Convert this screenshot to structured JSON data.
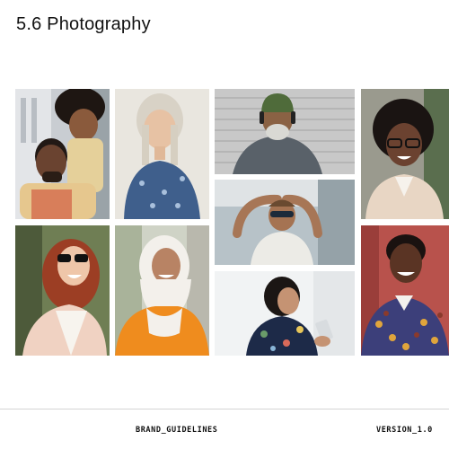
{
  "page": {
    "title": "5.6 Photography"
  },
  "photos": [
    {
      "id": "father-daughter",
      "subject": "smiling father with daughter on shoulders"
    },
    {
      "id": "older-woman",
      "subject": "smiling older woman with grey hair"
    },
    {
      "id": "man-beanie-headphones",
      "subject": "smiling bearded man in green beanie with headphones"
    },
    {
      "id": "woman-glasses",
      "subject": "smiling woman with natural hair and glasses"
    },
    {
      "id": "man-sunglasses-stretch",
      "subject": "man in sunglasses stretching arms above head"
    },
    {
      "id": "woman-red-hair-sunglasses",
      "subject": "laughing woman with red curly hair and sunglasses"
    },
    {
      "id": "woman-hijab",
      "subject": "smiling woman in white hijab and orange top"
    },
    {
      "id": "woman-phone",
      "subject": "woman in floral dress looking at phone"
    },
    {
      "id": "man-patterned-shirt",
      "subject": "laughing person in patterned shirt against red wall"
    }
  ],
  "footer": {
    "left": "BRAND_GUIDELINES",
    "right": "VERSION_1.0"
  }
}
